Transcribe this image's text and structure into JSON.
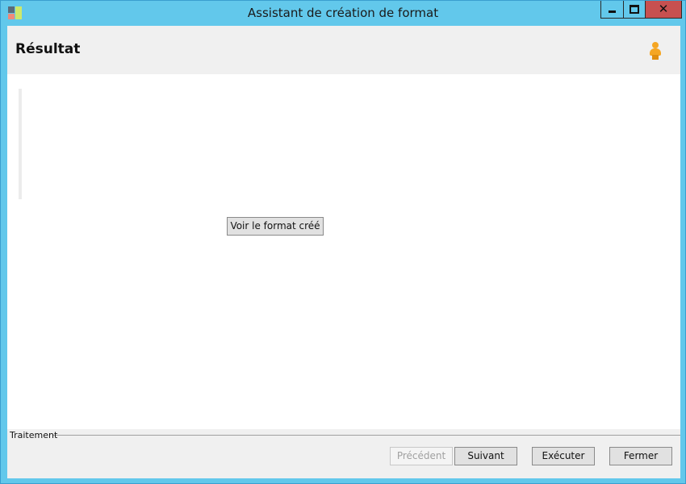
{
  "window": {
    "title": "Assistant de création de format",
    "close_symbol": "✕"
  },
  "header": {
    "title": "Résultat",
    "icon": "user-icon"
  },
  "main": {
    "view_button_label": "Voir le format créé"
  },
  "footer": {
    "group_label": "Traitement",
    "buttons": {
      "previous": "Précédent",
      "next": "Suivant",
      "execute": "Exécuter",
      "close": "Fermer"
    }
  },
  "colors": {
    "title_bar": "#62c8eb",
    "close_button": "#c75050",
    "header_bg": "#f0f0f0",
    "user_icon": "#f5a623"
  }
}
